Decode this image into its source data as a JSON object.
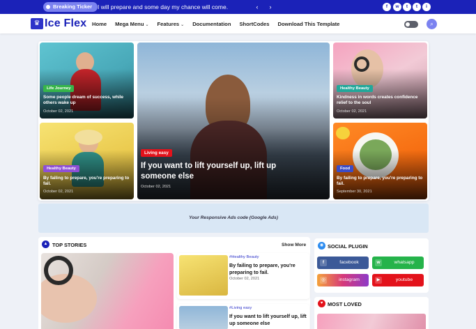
{
  "topbar": {
    "ticker_label": "Breaking Ticker",
    "ticker_text": "I will prepare and some day my chance will come.",
    "prev": "‹",
    "next": "›",
    "social_icons": [
      "facebook-icon",
      "whatsapp-icon",
      "telegram-icon",
      "twitter-icon",
      "instagram-icon"
    ],
    "social_glyphs": [
      "f",
      "w",
      "t",
      "t",
      "i"
    ],
    "bar_color": "#1b22b8"
  },
  "nav": {
    "logo": "Ice Flex",
    "menu": [
      {
        "label": "Home",
        "has_caret": false
      },
      {
        "label": "Mega Menu",
        "has_caret": true
      },
      {
        "label": "Features",
        "has_caret": true
      },
      {
        "label": "Documentation",
        "has_caret": false
      },
      {
        "label": "ShortCodes",
        "has_caret": false
      },
      {
        "label": "Download This Template",
        "has_caret": false
      }
    ],
    "caret": "⌄",
    "search_glyph": "⌕"
  },
  "hero": {
    "cards": [
      {
        "tag": "Life Journey",
        "tag_color": "#36b54a",
        "title": "Some people dream of success, while others wake up",
        "date": "October 02, 2021"
      },
      {
        "tag": "Healthy Beauty",
        "tag_color": "#8e4fd6",
        "title": "By failing to prepare, you're preparing to fail.",
        "date": "October 02, 2021"
      },
      {
        "tag": "Living easy",
        "tag_color": "#e3121b",
        "title": "If you want to lift yourself up, lift up someone else",
        "date": "October 02, 2021"
      },
      {
        "tag": "Healthy Beauty",
        "tag_color": "#21a89a",
        "title": "Kindness in words creates confidence relief to the soul",
        "date": "October 02, 2021"
      },
      {
        "tag": "Food",
        "tag_color": "#3b4cc7",
        "title": "By failing to prepare, you're preparing to fail.",
        "date": "September 30, 2021"
      }
    ]
  },
  "ads": {
    "text": "Your Responsive Ads code (Google Ads)"
  },
  "top_stories": {
    "title": "TOP STORIES",
    "show_more": "Show More",
    "items": [
      {
        "tag": "#Healthy Beauty",
        "title": "By failing to prepare, you're preparing to fail.",
        "date": "October 02, 2021"
      },
      {
        "tag": "#Living easy",
        "title": "If you want to lift yourself up, lift up someone else",
        "date": ""
      }
    ]
  },
  "social_plugin": {
    "title": "SOCIAL PLUGIN",
    "buttons": [
      {
        "label": "facebook",
        "color": "#3b5998",
        "glyph": "f",
        "icon": "facebook-icon"
      },
      {
        "label": "whatsapp",
        "color": "#25b34a",
        "glyph": "w",
        "icon": "whatsapp-icon"
      },
      {
        "label": "instagram",
        "color": "#d6397a",
        "glyph": "◎",
        "icon": "instagram-icon"
      },
      {
        "label": "youtube",
        "color": "#e3121b",
        "glyph": "▶",
        "icon": "youtube-icon"
      }
    ]
  },
  "most_loved": {
    "title": "MOST LOVED"
  }
}
